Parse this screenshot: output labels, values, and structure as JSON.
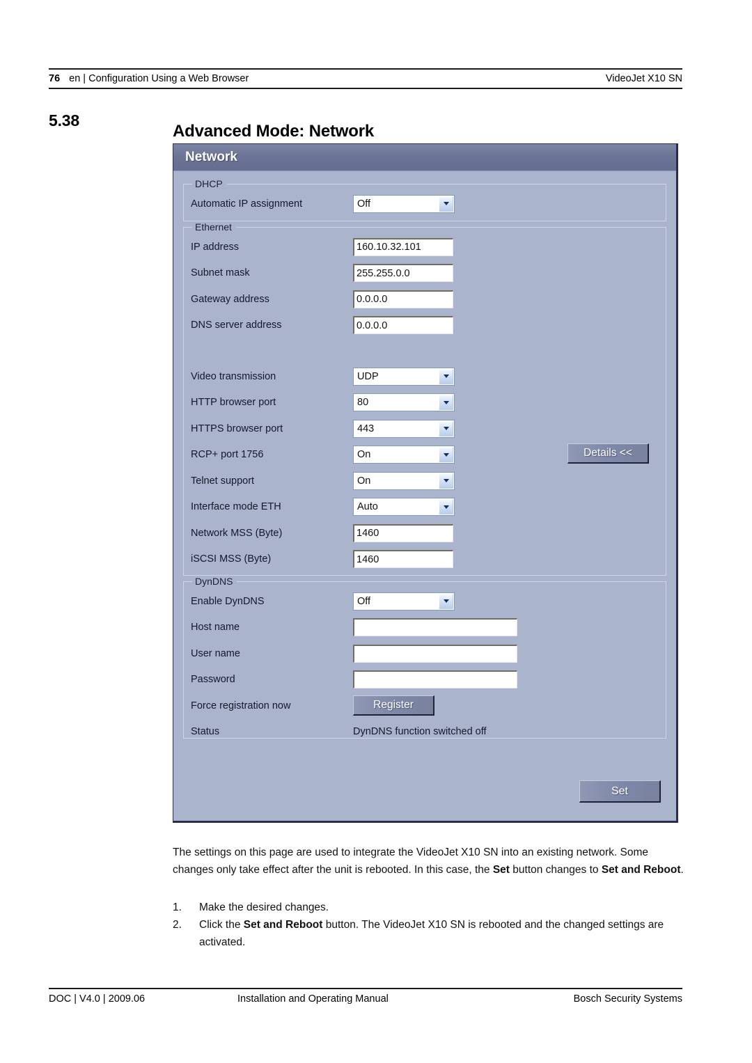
{
  "page_header": {
    "page_number": "76",
    "left_text": "en | Configuration Using a Web Browser",
    "right_text": "VideoJet X10 SN"
  },
  "section": {
    "number": "5.38",
    "title": "Advanced Mode: Network"
  },
  "panel": {
    "title": "Network",
    "groups": {
      "dhcp": {
        "legend": "DHCP",
        "rows": [
          {
            "label": "Automatic IP assignment",
            "type": "dropdown",
            "value": "Off"
          }
        ]
      },
      "ethernet": {
        "legend": "Ethernet",
        "rows": [
          {
            "label": "IP address",
            "type": "textbox",
            "value": "160.10.32.101"
          },
          {
            "label": "Subnet mask",
            "type": "textbox",
            "value": "255.255.0.0"
          },
          {
            "label": "Gateway address",
            "type": "textbox",
            "value": "0.0.0.0"
          },
          {
            "label": "DNS server address",
            "type": "textbox",
            "value": "0.0.0.0"
          },
          {
            "label": "Video transmission",
            "type": "dropdown",
            "value": "UDP"
          },
          {
            "label": "HTTP browser port",
            "type": "dropdown",
            "value": "80"
          },
          {
            "label": "HTTPS browser port",
            "type": "dropdown",
            "value": "443"
          },
          {
            "label": "RCP+ port 1756",
            "type": "dropdown",
            "value": "On"
          },
          {
            "label": "Telnet support",
            "type": "dropdown",
            "value": "On"
          },
          {
            "label": "Interface mode ETH",
            "type": "dropdown",
            "value": "Auto"
          },
          {
            "label": "Network MSS (Byte)",
            "type": "textbox",
            "value": "1460"
          },
          {
            "label": "iSCSI MSS (Byte)",
            "type": "textbox",
            "value": "1460"
          }
        ],
        "details_button": "Details <<"
      },
      "dyndns": {
        "legend": "DynDNS",
        "rows": [
          {
            "label": "Enable DynDNS",
            "type": "dropdown",
            "value": "Off"
          },
          {
            "label": "Host name",
            "type": "textbox-wide",
            "value": ""
          },
          {
            "label": "User name",
            "type": "textbox-wide",
            "value": ""
          },
          {
            "label": "Password",
            "type": "textbox-wide",
            "value": ""
          },
          {
            "label": "Force registration now",
            "type": "button",
            "value": "Register"
          },
          {
            "label": "Status",
            "type": "static",
            "value": "DynDNS function switched off"
          }
        ]
      }
    },
    "set_button": "Set"
  },
  "body": {
    "paragraph_part1": "The settings on this page are used to integrate the VideoJet X10 SN into an existing network. Some changes only take effect after the unit is rebooted. In this case, the ",
    "paragraph_bold1": "Set",
    "paragraph_part2": " button changes to ",
    "paragraph_bold2": "Set and Reboot",
    "paragraph_part3": ".",
    "list": [
      {
        "num": "1.",
        "text": "Make the desired changes."
      },
      {
        "num": "2.",
        "pre": "Click the ",
        "bold": "Set and Reboot",
        "post": " button. The VideoJet X10 SN is rebooted and the changed settings are activated."
      }
    ]
  },
  "page_footer": {
    "left": "DOC | V4.0 | 2009.06",
    "center": "Installation and Operating Manual",
    "right": "Bosch Security Systems"
  }
}
